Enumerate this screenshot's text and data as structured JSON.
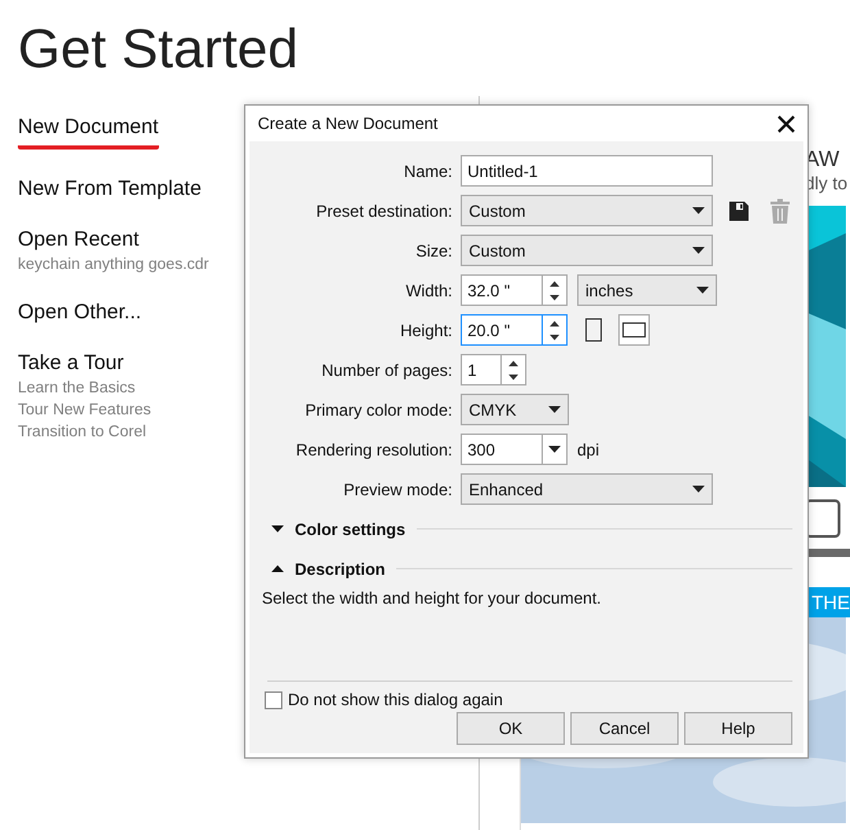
{
  "page_title": "Get Started",
  "nav": [
    {
      "label": "New Document",
      "selected": true
    },
    {
      "label": "New From Template",
      "selected": false
    },
    {
      "label": "Open Recent",
      "selected": false,
      "sublinks": [
        "keychain anything goes.cdr"
      ]
    },
    {
      "label": "Open Other...",
      "selected": false
    },
    {
      "label": "Take a Tour",
      "selected": false,
      "sublinks": [
        "Learn the Basics",
        "Tour New Features",
        "Transition to Corel"
      ]
    }
  ],
  "background_texts": [
    "AW",
    "dly to"
  ],
  "banner": "THE",
  "dialog": {
    "title": "Create a New Document",
    "fields": [
      {
        "kind": "text",
        "label": "Name:",
        "value": "Untitled-1"
      },
      {
        "kind": "select",
        "label": "Preset destination:",
        "value": "Custom",
        "actions": [
          {
            "kind": "save",
            "disabled": false
          },
          {
            "kind": "delete",
            "disabled": true
          }
        ]
      },
      {
        "kind": "select",
        "label": "Size:",
        "value": "Custom"
      },
      {
        "kind": "spin",
        "label": "Width:",
        "value": "32.0 \"",
        "focused": false,
        "unit": "inches"
      },
      {
        "kind": "spin",
        "label": "Height:",
        "value": "20.0 \"",
        "focused": true,
        "orientation": [
          {
            "kind": "portrait",
            "selected": false
          },
          {
            "kind": "landscape",
            "selected": true
          }
        ]
      },
      {
        "kind": "short_spin",
        "label": "Number of pages:",
        "value": "1",
        "focused": false
      },
      {
        "kind": "short_select",
        "label": "Primary color mode:",
        "value": "CMYK"
      },
      {
        "kind": "combo",
        "label": "Rendering resolution:",
        "value": "300",
        "suffix": "dpi"
      },
      {
        "kind": "select",
        "label": "Preview mode:",
        "value": "Enhanced"
      }
    ],
    "sections": [
      {
        "label": "Color settings",
        "expanded": false
      },
      {
        "label": "Description",
        "expanded": true,
        "text": "Select the width and height for your document."
      }
    ],
    "checkbox": {
      "label": "Do not show this dialog again",
      "checked": false
    },
    "buttons": [
      "OK",
      "Cancel",
      "Help"
    ]
  }
}
